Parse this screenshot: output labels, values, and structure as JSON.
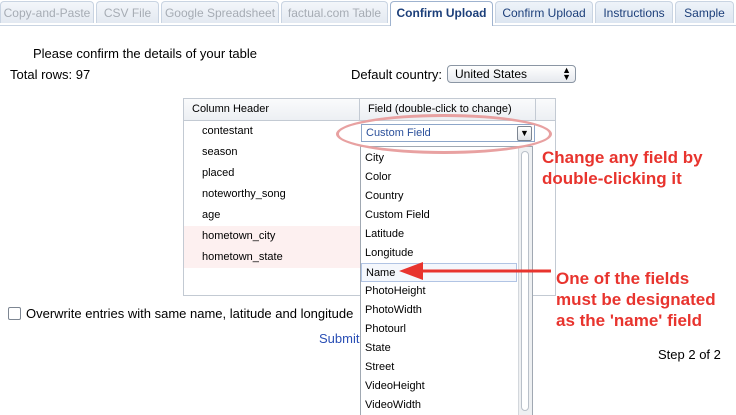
{
  "tabs": [
    {
      "label": "Copy-and-Paste",
      "state": "disabled"
    },
    {
      "label": "CSV File",
      "state": "disabled"
    },
    {
      "label": "Google Spreadsheet",
      "state": "disabled"
    },
    {
      "label": "factual.com Table",
      "state": "disabled"
    },
    {
      "label": "Confirm Upload",
      "state": "active"
    },
    {
      "label": "Confirm Upload",
      "state": "normal"
    },
    {
      "label": "Instructions",
      "state": "normal"
    },
    {
      "label": "Sample",
      "state": "normal"
    }
  ],
  "heading": "Please confirm the details of your table",
  "total_rows": "Total rows: 97",
  "country": {
    "label": "Default country:",
    "value": "United States"
  },
  "table": {
    "col1": "Column Header",
    "col2": "Field (double-click to change)",
    "rows": [
      "contestant",
      "season",
      "placed",
      "noteworthy_song",
      "age",
      "hometown_city",
      "hometown_state"
    ]
  },
  "field_dropdown": {
    "value": "Custom Field",
    "options": [
      "City",
      "Color",
      "Country",
      "Custom Field",
      "Latitude",
      "Longitude",
      "Name",
      "PhotoHeight",
      "PhotoWidth",
      "Photourl",
      "State",
      "Street",
      "VideoHeight",
      "VideoWidth"
    ]
  },
  "overwrite_label": "Overwrite entries with same name, latitude and longitude",
  "submit_label": "Submit",
  "step": "Step 2 of 2",
  "annotations": {
    "top": "Change any field by double-clicking it",
    "bottom": "One of the fields must be designated as the 'name' field"
  },
  "colors": {
    "annotation": "#e8342e",
    "ellipse": "#e8a1a1",
    "row_highlight": "#fdf0f0"
  }
}
